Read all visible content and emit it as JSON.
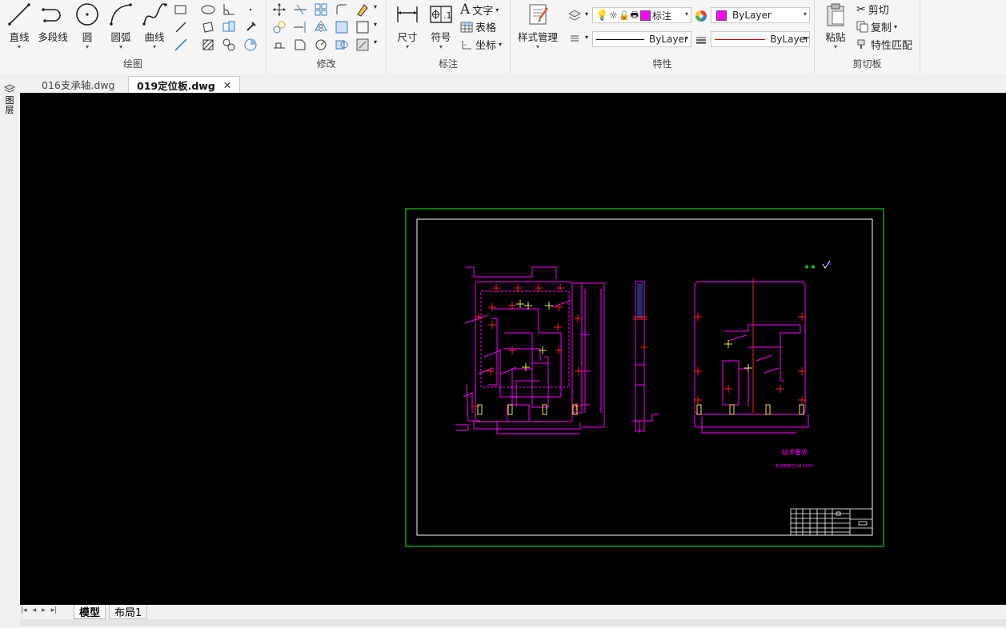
{
  "ribbon": {
    "draw": {
      "title": "绘图",
      "line": "直线",
      "polyline": "多段线",
      "circle": "圆",
      "arc": "圆弧",
      "curve": "曲线"
    },
    "modify": {
      "title": "修改"
    },
    "annotate": {
      "title": "标注",
      "dimension": "尺寸",
      "symbol": "符号",
      "text": "文字",
      "table": "表格",
      "coordinate": "坐标"
    },
    "properties": {
      "title": "特性",
      "style_manager": "样式管理",
      "layer_value": "标注",
      "color_value": "ByLayer",
      "linetype_value": "ByLayer",
      "lineweight_value": "ByLayer",
      "colors": {
        "magenta": "#ff00ff",
        "lineweight_red": "#cc0000"
      }
    },
    "clipboard": {
      "title": "剪切板",
      "paste": "粘贴",
      "cut": "剪切",
      "copy": "复制",
      "match": "特性匹配"
    }
  },
  "tabs": [
    {
      "label": "016支承轴.dwg",
      "active": false
    },
    {
      "label": "019定位板.dwg",
      "active": true
    }
  ],
  "side_label": "图层",
  "drawing": {
    "notes_title": "技术要求",
    "notes_body": "未注倒角均为0.5x45°"
  },
  "layout_tabs": [
    {
      "label": "模型",
      "active": true
    },
    {
      "label": "布局1",
      "active": false
    }
  ],
  "nav_arrows": [
    "|◂",
    "◂",
    "▸",
    "▸|"
  ]
}
